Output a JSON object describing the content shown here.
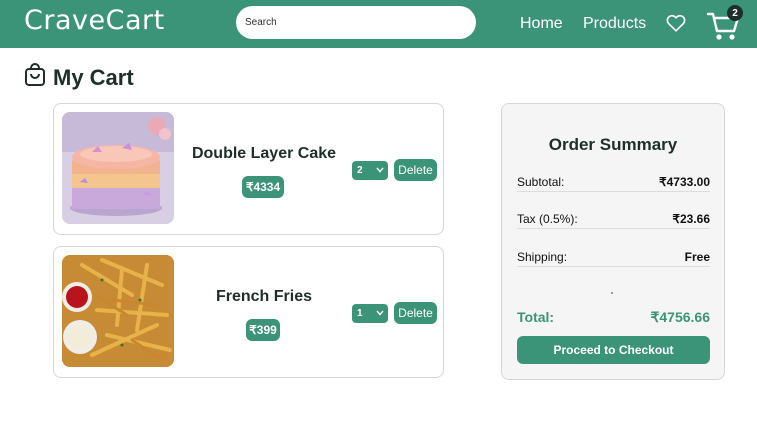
{
  "navbar": {
    "brand": "CraveCart",
    "search_placeholder": "Search",
    "links": [
      "Home",
      "Products"
    ],
    "cart_count": "2",
    "icons": [
      "heart-icon",
      "cart-icon"
    ]
  },
  "page": {
    "title": "My Cart",
    "title_icon": "shopping-bag-icon"
  },
  "cart_items": [
    {
      "name": "Double Layer Cake",
      "price": "₹4334",
      "quantity": "2",
      "delete_label": "Delete",
      "image": "cake-image"
    },
    {
      "name": "French Fries",
      "price": "₹399",
      "quantity": "1",
      "delete_label": "Delete",
      "image": "fries-image"
    }
  ],
  "summary": {
    "title": "Order Summary",
    "subtotal_label": "Subtotal:",
    "subtotal_value": "₹4733.00",
    "tax_label": "Tax (0.5%):",
    "tax_value": "₹23.66",
    "shipping_label": "Shipping:",
    "shipping_value": "Free",
    "total_label": "Total:",
    "total_value": "₹4756.66",
    "checkout_label": "Proceed to Checkout"
  },
  "colors": {
    "brand_green": "#3b9478",
    "dark_text": "#1e2f2a",
    "summary_bg": "#f5f5f5"
  }
}
